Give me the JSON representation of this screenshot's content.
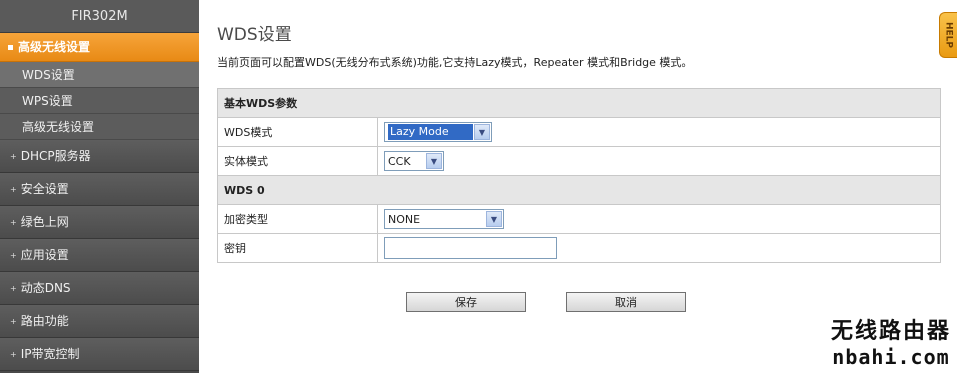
{
  "sidebar": {
    "brand": "FIR302M",
    "active_section": "高级无线设置",
    "sub_items": [
      {
        "label": "WDS设置",
        "selected": true
      },
      {
        "label": "WPS设置",
        "selected": false
      },
      {
        "label": "高级无线设置",
        "selected": false
      }
    ],
    "items": [
      {
        "label": "DHCP服务器"
      },
      {
        "label": "安全设置"
      },
      {
        "label": "绿色上网"
      },
      {
        "label": "应用设置"
      },
      {
        "label": "动态DNS"
      },
      {
        "label": "路由功能"
      },
      {
        "label": "IP带宽控制"
      }
    ]
  },
  "main": {
    "title": "WDS设置",
    "description": "当前页面可以配置WDS(无线分布式系统)功能,它支持Lazy模式，Repeater 模式和Bridge 模式。",
    "section_basic": "基本WDS参数",
    "wds_mode_label": "WDS模式",
    "wds_mode_value": "Lazy Mode",
    "physical_mode_label": "实体模式",
    "physical_mode_value": "CCK",
    "section_wds0": "WDS 0",
    "encryption_label": "加密类型",
    "encryption_value": "NONE",
    "key_label": "密钥",
    "key_value": "",
    "save_label": "保存",
    "cancel_label": "取消"
  },
  "help_label": "HELP",
  "watermark": {
    "line1": "无线路由器",
    "line2": "nbahi.com"
  },
  "colors": {
    "sidebar_bg": "#4a4a4a",
    "active_orange": "#f39c2a",
    "header_row_bg": "#e6e6e6"
  }
}
